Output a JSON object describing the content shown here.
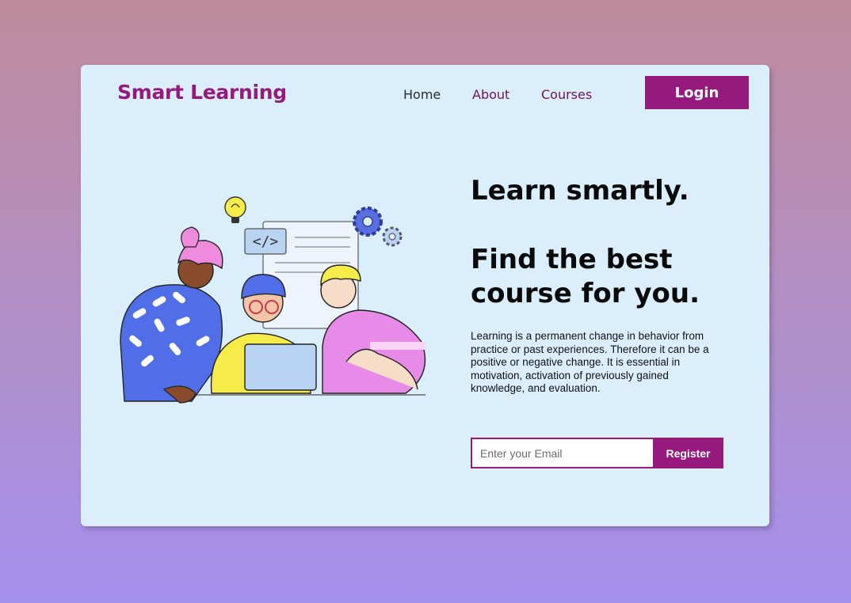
{
  "brand": {
    "name": "Smart Learning",
    "color": "#961a7e"
  },
  "nav": {
    "items": [
      {
        "label": "Home"
      },
      {
        "label": "About"
      },
      {
        "label": "Courses"
      }
    ],
    "login_label": "Login"
  },
  "hero": {
    "headline_line1": "Learn smartly.",
    "headline_line2": "Find the best course for you.",
    "description": "Learning is a permanent change in behavior from practice or past experiences. Therefore it can be a positive or negative change. It is essential in motivation, activation of previously gained knowledge, and evaluation.",
    "illustration": "students-collaborating-at-laptop"
  },
  "signup": {
    "email_placeholder": "Enter your Email",
    "register_label": "Register"
  },
  "colors": {
    "accent": "#961a7e",
    "card_background": "#dbeefc",
    "page_gradient_top": "#be8b9c",
    "page_gradient_bottom": "#a490ee"
  }
}
